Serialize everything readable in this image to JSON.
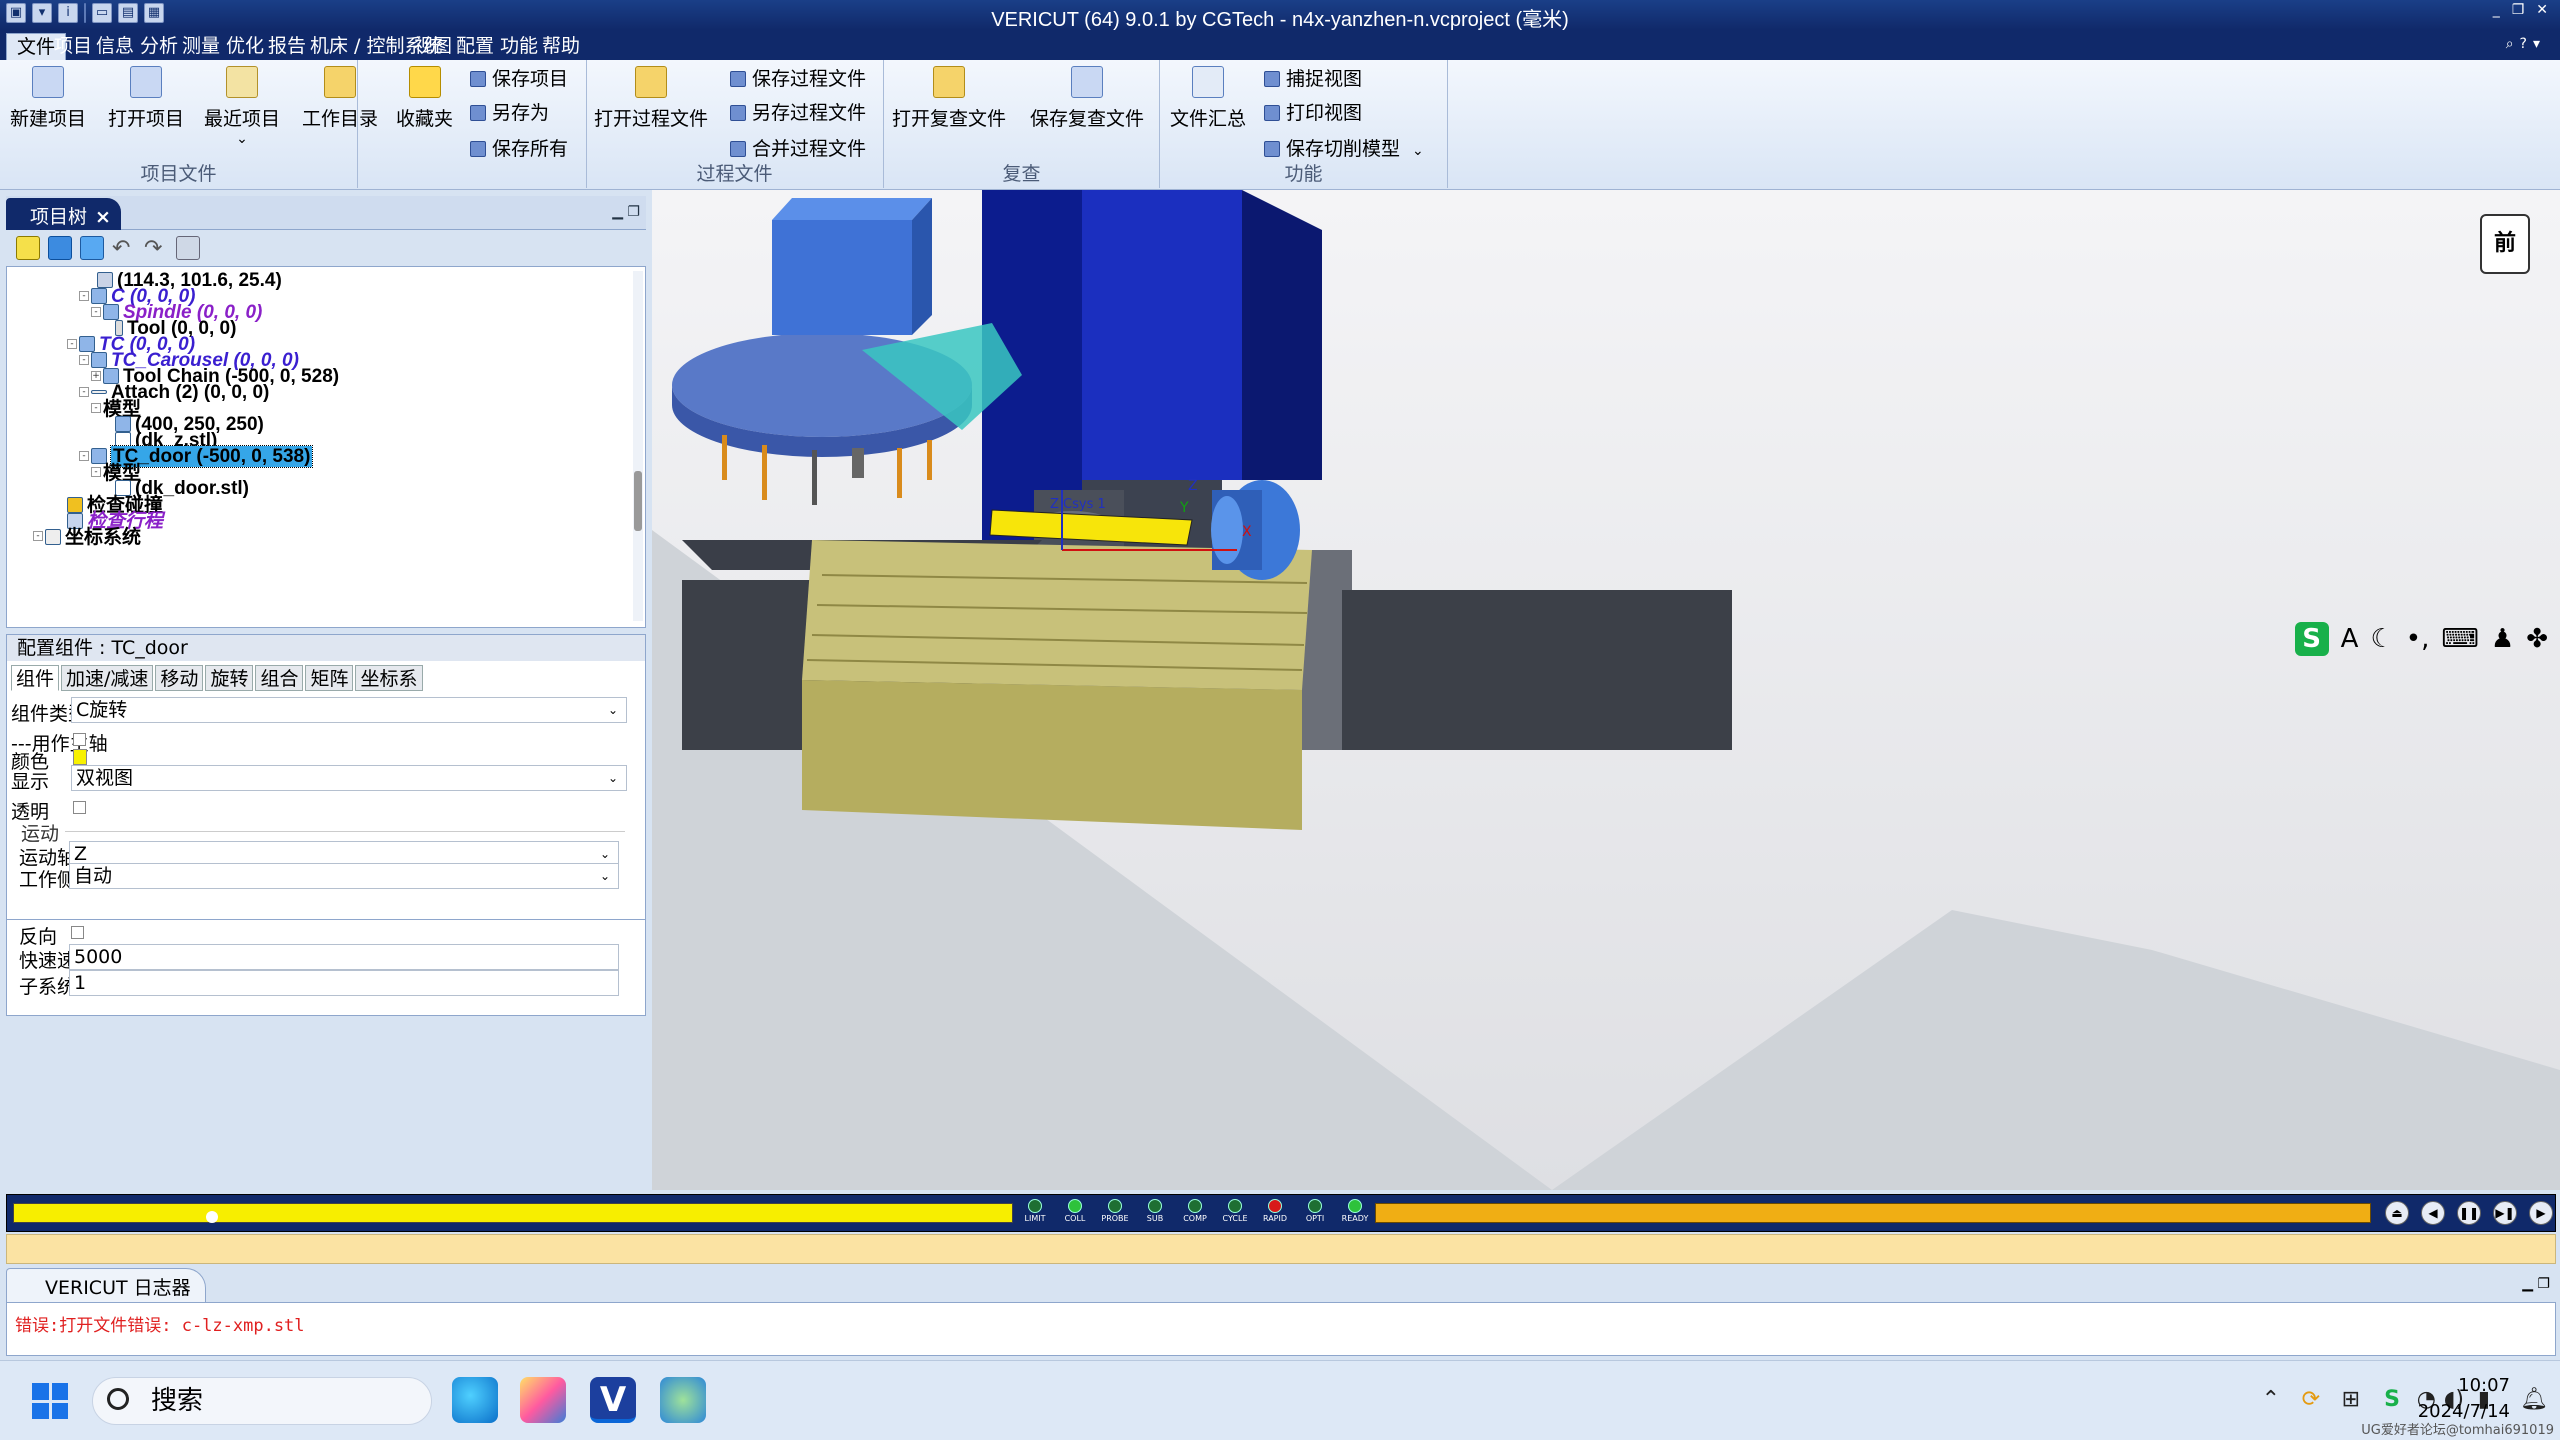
{
  "window": {
    "title": "VERICUT  (64)  9.0.1 by CGTech - n4x-yanzhen-n.vcproject (毫米)"
  },
  "menu": [
    "文件",
    "项目",
    "信息",
    "分析",
    "测量",
    "优化",
    "报告",
    "机床 / 控制系统",
    "视图",
    "配置",
    "功能",
    "帮助"
  ],
  "ribbon": {
    "groups": [
      {
        "label": "项目文件"
      },
      {
        "label": "过程文件"
      },
      {
        "label": "复查"
      },
      {
        "label": "功能"
      }
    ],
    "new_project": "新建项目",
    "open_project": "打开项目",
    "recent_project": "最近项目",
    "work_dir": "工作目录",
    "favorites": "收藏夹",
    "save_project": "保存项目",
    "save_as": "另存为",
    "save_all": "保存所有",
    "open_process": "打开过程文件",
    "save_process": "保存过程文件",
    "save_process_as": "另存过程文件",
    "merge_process": "合并过程文件",
    "open_review": "打开复查文件",
    "save_review": "保存复查文件",
    "file_summary": "文件汇总",
    "capture_view": "捕捉视图",
    "print_view": "打印视图",
    "save_cut_model": "保存切削模型"
  },
  "project_tree": {
    "tab": "项目树",
    "nodes": [
      "(114.3, 101.6, 25.4)",
      "C (0, 0, 0)",
      "Spindle (0, 0, 0)",
      "Tool (0, 0, 0)",
      "TC (0, 0, 0)",
      "TC_Carousel (0, 0, 0)",
      "Tool Chain (-500, 0, 528)",
      "Attach (2) (0, 0, 0)",
      "模型",
      "(400, 250, 250)",
      "(dk_z.stl)",
      "TC_door (-500, 0, 538)",
      "模型",
      "(dk_door.stl)",
      "检查碰撞",
      "检查行程",
      "坐标系统"
    ]
  },
  "config": {
    "title": "配置组件 : TC_door",
    "tabs": [
      "组件",
      "加速/减速",
      "移动",
      "旋转",
      "组合",
      "矩阵",
      "坐标系"
    ],
    "component_type_label": "组件类型",
    "component_type": "C旋转",
    "spindle_label": "---用作主轴",
    "color_label": "颜色",
    "display_label": "显示",
    "display": "双视图",
    "transparent_label": "透明",
    "motion_section": "运动",
    "axis_label": "运动轴",
    "axis": "Z",
    "side_label": "工作侧",
    "side": "自动",
    "reverse_label": "反向",
    "rapid_label": "快速速度",
    "rapid": "5000",
    "subsystem_label": "子系统",
    "subsystem": "1"
  },
  "viewport": {
    "view_label": "前",
    "axis_x": "X",
    "axis_y": "Y",
    "axis_z": "Z",
    "csys_label": "Z Csys 1"
  },
  "status_leds": [
    "LIMIT",
    "COLL",
    "PROBE",
    "SUB",
    "COMP",
    "CYCLE",
    "RAPID",
    "OPTI",
    "READY"
  ],
  "log": {
    "tab": "VERICUT 日志器",
    "lines": [
      "错误:打开文件错误: c-lz-xmp.stl"
    ]
  },
  "taskbar": {
    "search": "搜索",
    "time": "10:07",
    "date": "2024/7/14",
    "watermark": "UG爱好者论坛@tomhai691019"
  },
  "colors": {
    "accent": "#10296a",
    "simbar_yellow": "#f7ee00",
    "simbar_orange": "#f0ae14",
    "selection": "#35a6e8"
  }
}
